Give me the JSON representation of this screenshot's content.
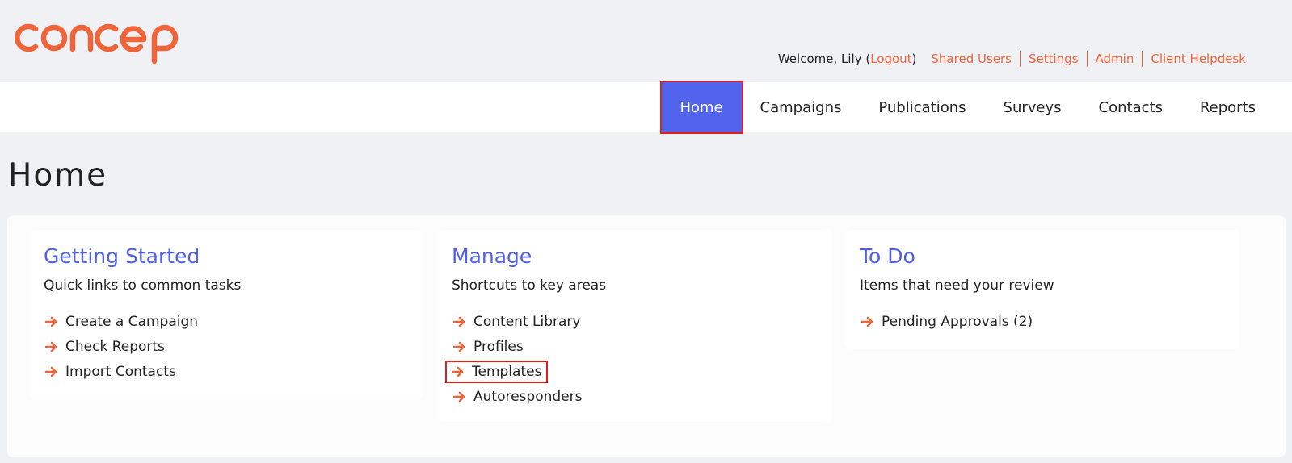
{
  "brand": {
    "logo_text": "concep",
    "color": "#f0643a"
  },
  "header": {
    "welcome_prefix": "Welcome, Lily (",
    "logout_label": "Logout",
    "welcome_suffix": ")",
    "links": [
      {
        "label": "Shared Users"
      },
      {
        "label": "Settings"
      },
      {
        "label": "Admin"
      },
      {
        "label": "Client Helpdesk"
      }
    ]
  },
  "nav": {
    "items": [
      {
        "label": "Home",
        "active": true
      },
      {
        "label": "Campaigns"
      },
      {
        "label": "Publications"
      },
      {
        "label": "Surveys"
      },
      {
        "label": "Contacts"
      },
      {
        "label": "Reports"
      }
    ],
    "active_color": "#5263ee"
  },
  "page": {
    "title": "Home"
  },
  "cards": [
    {
      "title": "Getting Started",
      "subtitle": "Quick links to common tasks",
      "links": [
        "Create a Campaign",
        "Check Reports",
        "Import Contacts"
      ]
    },
    {
      "title": "Manage",
      "subtitle": "Shortcuts to key areas",
      "links": [
        "Content Library",
        "Profiles",
        "Templates",
        "Autoresponders"
      ]
    },
    {
      "title": "To Do",
      "subtitle": "Items that need your review",
      "links": [
        "Pending Approvals (2)"
      ]
    }
  ],
  "icons": {
    "arrow": "arrow-right-icon",
    "arrow_color": "#f0643a"
  }
}
